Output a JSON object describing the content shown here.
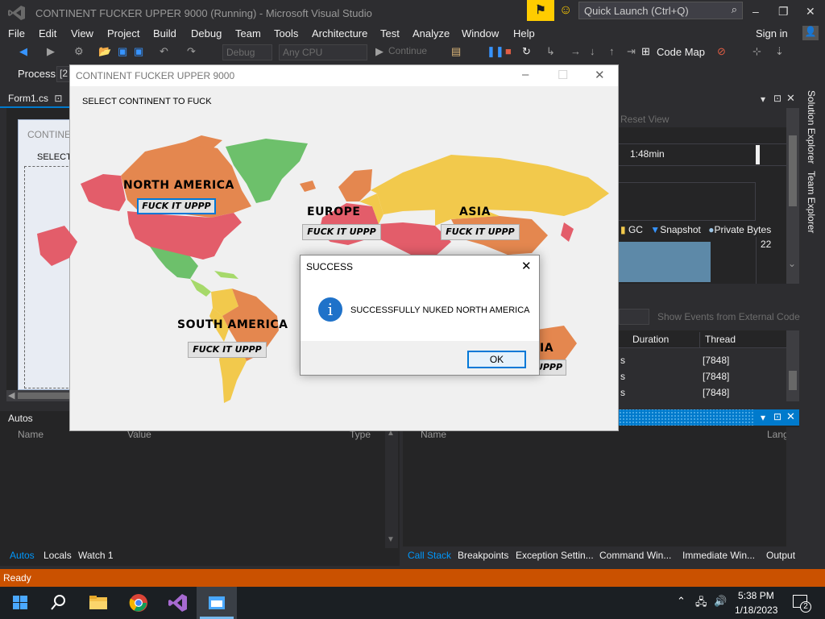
{
  "vs": {
    "title": "CONTINENT FUCKER UPPER 9000 (Running) - Microsoft Visual Studio",
    "quick_launch_placeholder": "Quick Launch (Ctrl+Q)",
    "menu": [
      "File",
      "Edit",
      "View",
      "Project",
      "Build",
      "Debug",
      "Team",
      "Tools",
      "Architecture",
      "Test",
      "Analyze",
      "Window",
      "Help"
    ],
    "sign_in": "Sign in",
    "toolbar": {
      "config": "Debug",
      "platform": "Any CPU",
      "continue": "Continue",
      "code_map": "Code Map"
    },
    "process_label": "Process:",
    "process_value": "[2",
    "doc_tab": "Form1.cs",
    "designer": {
      "form_title": "CONTINE",
      "form_label": "SELECT"
    },
    "diagnostics": {
      "reset_view": "Reset View",
      "time": "1:48min",
      "legend": {
        "gc": "GC",
        "snapshot": "Snapshot",
        "private_bytes": "Private Bytes"
      },
      "memory_value": "22",
      "memory_fill": 0.55
    },
    "side_tabs": [
      "Solution Explorer",
      "Team Explorer"
    ],
    "events": {
      "show_external": "Show Events from External Code",
      "columns": [
        "Duration",
        "Thread"
      ],
      "rows": [
        {
          "duration": "s",
          "thread": "[7848]"
        },
        {
          "duration": "s",
          "thread": "[7848]"
        },
        {
          "duration": "s",
          "thread": "[7848]"
        }
      ]
    },
    "autos": {
      "title": "Autos",
      "columns": [
        "Name",
        "Value",
        "Type"
      ],
      "tabs": [
        "Autos",
        "Locals",
        "Watch 1"
      ]
    },
    "callstack": {
      "columns": [
        "Name",
        "Lang"
      ],
      "tabs": [
        "Call Stack",
        "Breakpoints",
        "Exception Settin...",
        "Command Win...",
        "Immediate Win...",
        "Output"
      ]
    },
    "status": "Ready"
  },
  "taskbar": {
    "time": "5:38 PM",
    "date": "1/18/2023",
    "notification_count": "2"
  },
  "form": {
    "title": "CONTINENT FUCKER UPPER 9000",
    "instruction": "SELECT CONTINENT TO FUCK",
    "continents": [
      {
        "name": "NORTH AMERICA",
        "button": "FUCK IT UPPP"
      },
      {
        "name": "EUROPE",
        "button": "FUCK IT UPPP"
      },
      {
        "name": "ASIA",
        "button": "FUCK IT UPPP"
      },
      {
        "name": "SOUTH AMERICA",
        "button": "FUCK IT UPPP"
      },
      {
        "name": "IA",
        "button": "UPPP"
      }
    ]
  },
  "dialog": {
    "title": "SUCCESS",
    "message": "SUCCESSFULLY NUKED NORTH AMERICA",
    "ok": "OK",
    "icon": "info-icon"
  },
  "colors": {
    "accent": "#007acc",
    "status_bar": "#ca5100",
    "map_red": "#e35d6a",
    "map_orange": "#e4874f",
    "map_yellow": "#f2c94c",
    "map_green": "#6dc06b",
    "map_lightgreen": "#a6d96a",
    "map_blue": "#5d89a8"
  }
}
